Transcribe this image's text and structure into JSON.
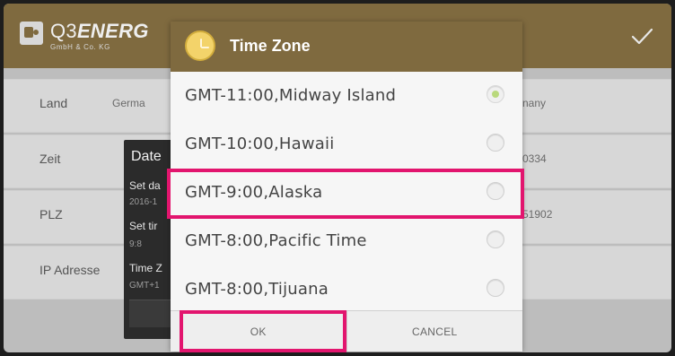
{
  "header": {
    "brand_q3": "Q3",
    "brand_energy": "ENERG",
    "brand_sub": "GmbH & Co. KG"
  },
  "rows": [
    {
      "label": "Land",
      "value": "Germa",
      "right_value": "nany"
    },
    {
      "label": "Zeit",
      "value": "",
      "right_value": "0334"
    },
    {
      "label": "PLZ",
      "value": "",
      "right_value": "51902"
    },
    {
      "label": "IP Adresse",
      "value": "",
      "right_value": ""
    }
  ],
  "background_dialog": {
    "title": "Date",
    "set_date": "Set da",
    "date_value": "2016-1",
    "set_time": "Set tir",
    "time_value": "9:8",
    "time_zone": "Time Z",
    "tz_value": "GMT+1"
  },
  "timezone_dialog": {
    "title": "Time Zone",
    "items": [
      {
        "text": "GMT-11:00,Midway Island",
        "selected": true
      },
      {
        "text": "GMT-10:00,Hawaii",
        "selected": false
      },
      {
        "text": "GMT-9:00,Alaska",
        "selected": false
      },
      {
        "text": "GMT-8:00,Pacific Time",
        "selected": false
      },
      {
        "text": "GMT-8:00,Tijuana",
        "selected": false
      }
    ],
    "ok_label": "OK",
    "cancel_label": "CANCEL"
  },
  "colors": {
    "header_brown": "#7f6a3f",
    "highlight": "#e2156e",
    "radio_selected": "#b9d97c"
  }
}
